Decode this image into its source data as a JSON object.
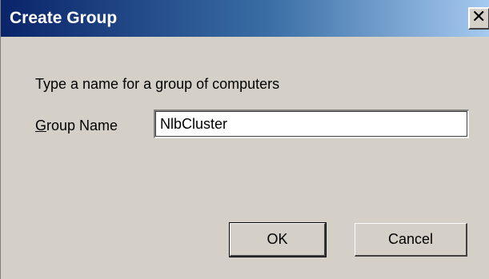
{
  "dialog": {
    "title": "Create Group",
    "close_glyph": "✕",
    "prompt": "Type a name for a group of computers",
    "field_label_mnemonic": "G",
    "field_label_rest": "roup Name",
    "input_value": "NlbCluster",
    "ok_label": "OK",
    "cancel_label": "Cancel"
  },
  "colors": {
    "titlebar_start": "#0a246a",
    "titlebar_end": "#a6caf0",
    "dialog_bg": "#d4d0c8"
  }
}
